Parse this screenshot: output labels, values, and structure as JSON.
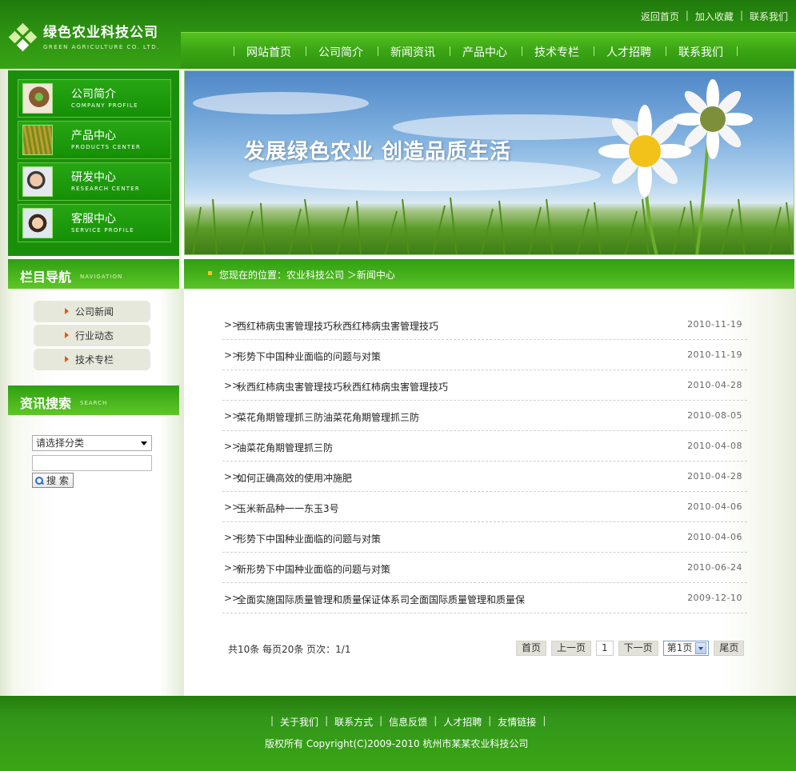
{
  "brand": {
    "name": "绿色农业科技公司",
    "name_en": "GREEN AGRICULTURE CO. LTD."
  },
  "toplinks": [
    "返回首页",
    "加入收藏",
    "联系我们"
  ],
  "nav": [
    "网站首页",
    "公司简介",
    "新闻资讯",
    "产品中心",
    "技术专栏",
    "人才招聘",
    "联系我们"
  ],
  "quick": [
    {
      "cn": "公司简介",
      "en": "COMPANY PROFILE"
    },
    {
      "cn": "产品中心",
      "en": "PRODUCTS CENTER"
    },
    {
      "cn": "研发中心",
      "en": "RESEARCH CENTER"
    },
    {
      "cn": "客服中心",
      "en": "SERVICE PROFILE"
    }
  ],
  "catnav": {
    "title": "栏目导航",
    "title_en": "NAVIGATION",
    "items": [
      "公司新闻",
      "行业动态",
      "技术专栏"
    ]
  },
  "search": {
    "title": "资讯搜索",
    "title_en": "SEARCH",
    "select": "请选择分类",
    "input": "",
    "button": "搜 索"
  },
  "banner": {
    "slogan": "发展绿色农业 创造品质生活"
  },
  "crumb": "您现在的位置：农业科技公司 ＞新闻中心",
  "news": [
    {
      "title": "西红柿病虫害管理技巧秋西红柿病虫害管理技巧",
      "date": "2010-11-19"
    },
    {
      "title": "形势下中国种业面临的问题与对策",
      "date": "2010-11-19"
    },
    {
      "title": "秋西红柿病虫害管理技巧秋西红柿病虫害管理技巧",
      "date": "2010-04-28"
    },
    {
      "title": "菜花角期管理抓三防油菜花角期管理抓三防",
      "date": "2010-08-05"
    },
    {
      "title": "油菜花角期管理抓三防",
      "date": "2010-04-08"
    },
    {
      "title": "如何正确高效的使用冲施肥",
      "date": "2010-04-28"
    },
    {
      "title": "玉米新品种一一东玉3号",
      "date": "2010-04-06"
    },
    {
      "title": "形势下中国种业面临的问题与对策",
      "date": "2010-04-06"
    },
    {
      "title": "新形势下中国种业面临的问题与对策",
      "date": "2010-06-24"
    },
    {
      "title": "全面实施国际质量管理和质量保证体系司全面国际质量管理和质量保",
      "date": "2009-12-10"
    }
  ],
  "pageinfo": "共10条  每页20条  页次：1/1",
  "pager": {
    "first": "首页",
    "prev": "上一页",
    "current": "1",
    "next": "下一页",
    "select": "第1页",
    "last": "尾页"
  },
  "footer": {
    "links": [
      "关于我们",
      "联系方式",
      "信息反馈",
      "人才招聘",
      "友情链接"
    ],
    "copyright": "版权所有  Copyright(C)2009-2010 杭州市某某农业科技公司"
  },
  "colors": {
    "brand_green": "#2f9410",
    "accent_orange": "#e05a10",
    "crumb_square": "#f0c32a"
  }
}
